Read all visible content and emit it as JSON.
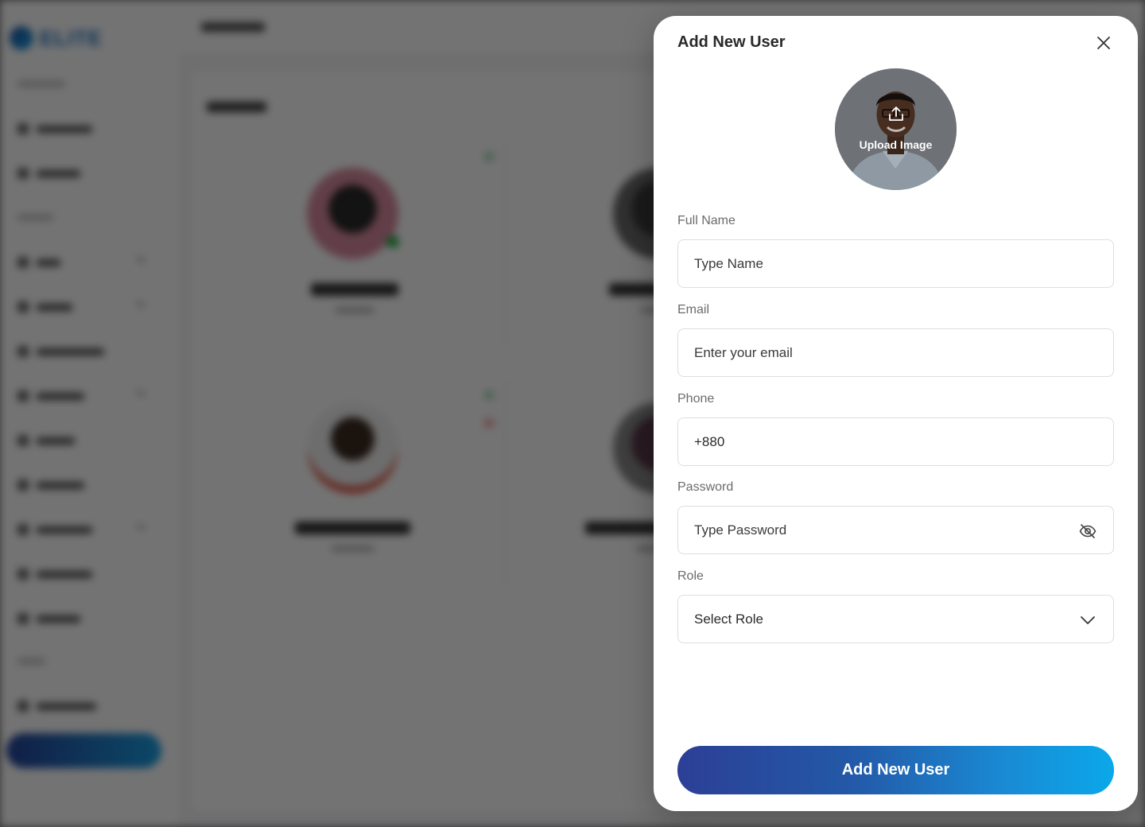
{
  "modal": {
    "title": "Add New User",
    "upload_label": "Upload Image",
    "fields": {
      "full_name": {
        "label": "Full Name",
        "placeholder": "Type Name"
      },
      "email": {
        "label": "Email",
        "placeholder": "Enter your email"
      },
      "phone": {
        "label": "Phone",
        "value": "+880"
      },
      "password": {
        "label": "Password",
        "placeholder": "Type Password"
      },
      "role": {
        "label": "Role",
        "selected": "Select Role"
      }
    },
    "submit_label": "Add New User"
  },
  "colors": {
    "accent_start": "#2c3f96",
    "accent_end": "#0aa8ea",
    "overlay": "#000000"
  },
  "icons": {
    "close": "close-icon",
    "upload": "upload-icon",
    "password_toggle": "eye-off-icon",
    "role_dropdown": "chevron-down-icon"
  }
}
